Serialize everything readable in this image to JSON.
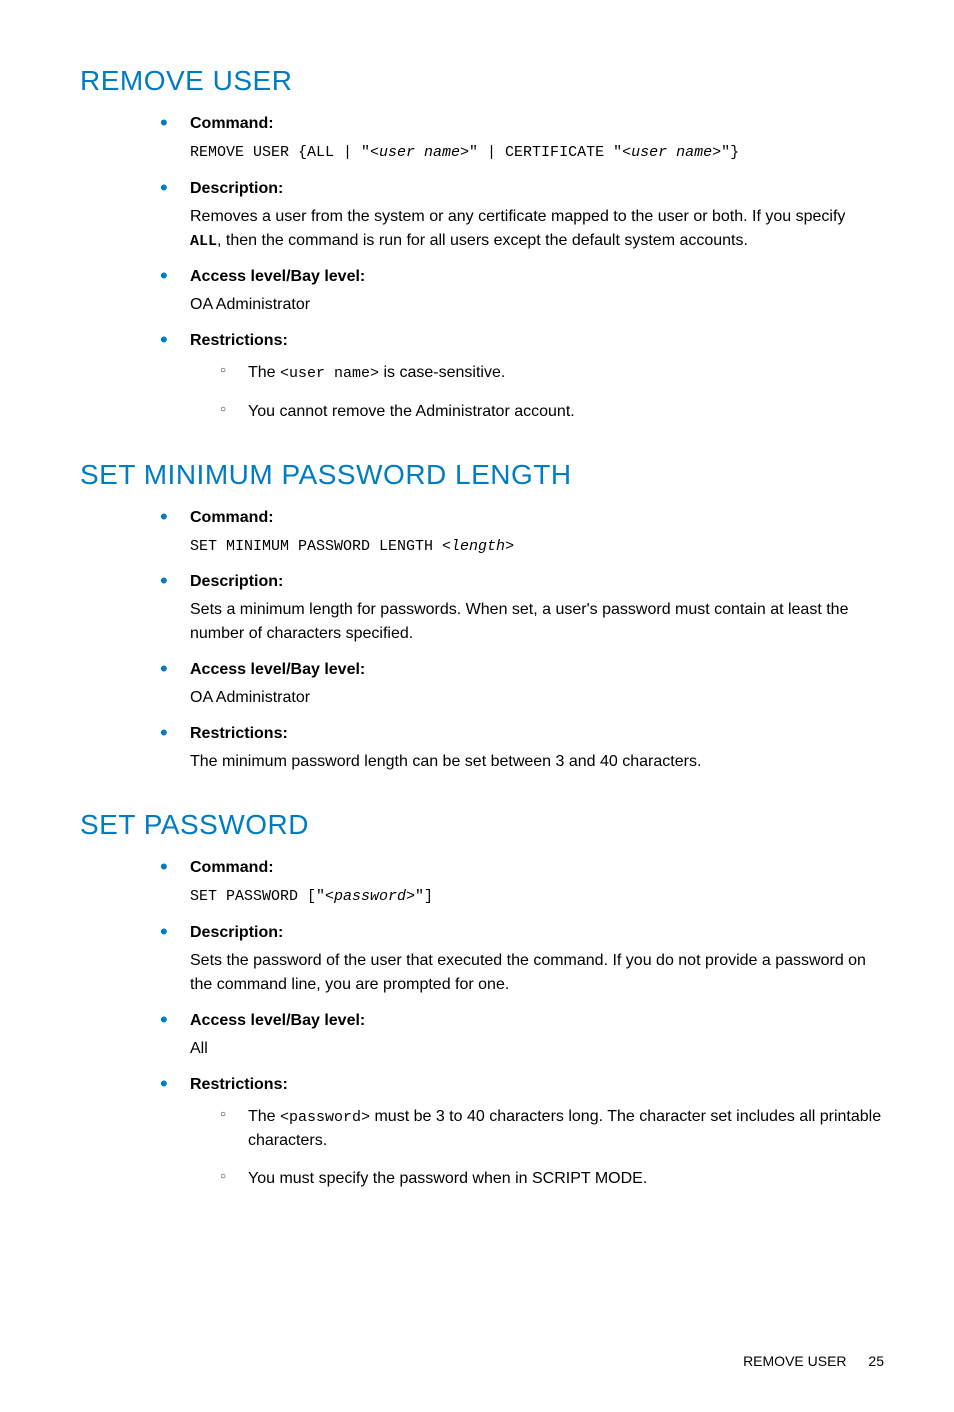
{
  "sections": [
    {
      "title": "REMOVE USER",
      "command_label": "Command:",
      "command_pre": "REMOVE USER {ALL | \"<",
      "command_arg1": "user name",
      "command_mid": ">\" | CERTIFICATE \"<",
      "command_arg2": "user name",
      "command_post": ">\"}",
      "description_label": "Description:",
      "description_pre": "Removes a user from the system or any certificate mapped to the user or both. If you specify ",
      "description_code": "ALL",
      "description_post": ", then the command is run for all users except the default system accounts.",
      "access_label": "Access level/Bay level:",
      "access_text": "OA Administrator",
      "restrictions_label": "Restrictions:",
      "restrictions_items": [
        {
          "pre": "The ",
          "code": "<user name>",
          "post": " is case-sensitive."
        },
        {
          "pre": "You cannot remove the Administrator account.",
          "code": "",
          "post": ""
        }
      ]
    },
    {
      "title": "SET MINIMUM PASSWORD LENGTH",
      "command_label": "Command:",
      "command_pre": "SET MINIMUM PASSWORD LENGTH <",
      "command_arg1": "length",
      "command_mid": "",
      "command_arg2": "",
      "command_post": ">",
      "description_label": "Description:",
      "description_pre": "Sets a minimum length for passwords. When set, a user's password must contain at least the number of characters specified.",
      "description_code": "",
      "description_post": "",
      "access_label": "Access level/Bay level:",
      "access_text": "OA Administrator",
      "restrictions_label": "Restrictions:",
      "restrictions_text": "The minimum password length can be set between 3 and 40 characters."
    },
    {
      "title": "SET PASSWORD",
      "command_label": "Command:",
      "command_pre": "SET PASSWORD [\"<",
      "command_arg1": "password",
      "command_mid": "",
      "command_arg2": "",
      "command_post": ">\"]",
      "description_label": "Description:",
      "description_pre": "Sets the password of the user that executed the command. If you do not provide a password on the command line, you are prompted for one.",
      "description_code": "",
      "description_post": "",
      "access_label": "Access level/Bay level:",
      "access_text": "All",
      "restrictions_label": "Restrictions:",
      "restrictions_items": [
        {
          "pre": "The ",
          "code": "<password>",
          "post": " must be 3 to 40 characters long. The character set includes all printable characters."
        },
        {
          "pre": "You must specify the password when in SCRIPT MODE.",
          "code": "",
          "post": ""
        }
      ]
    }
  ],
  "footer": {
    "title": "REMOVE USER",
    "page": "25"
  }
}
